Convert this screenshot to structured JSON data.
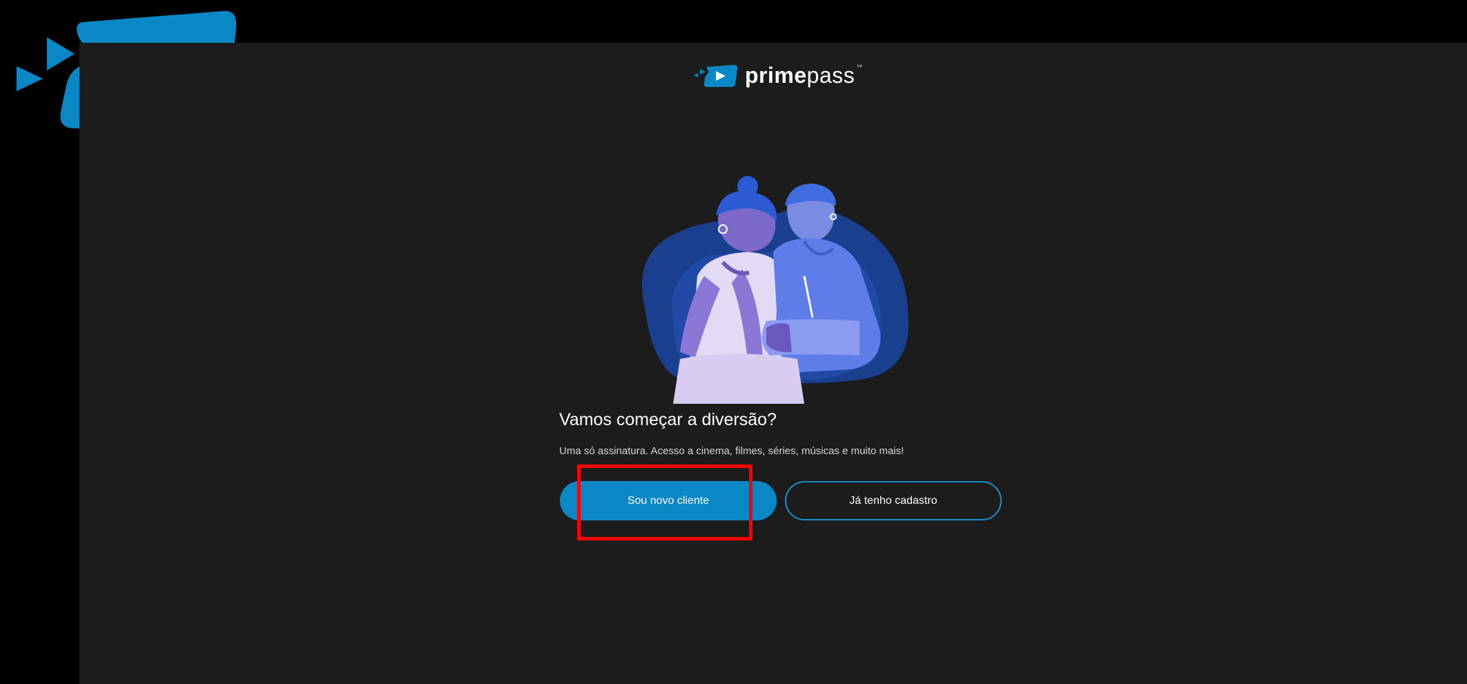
{
  "brand": {
    "name_bold": "prime",
    "name_light": "pass",
    "trademark": "™",
    "accent_color": "#0a88c6"
  },
  "icons": {
    "corner_logo": "play-icon",
    "brand_logo": "play-icon"
  },
  "illustration": {
    "name": "couple-illustration"
  },
  "main": {
    "heading": "Vamos começar a diversão?",
    "subtitle": "Uma só assinatura. Acesso a cinema, filmes, séries, músicas e muito mais!",
    "primary_button": "Sou novo cliente",
    "secondary_button": "Já tenho cadastro"
  },
  "annotation": {
    "highlight_color": "#ff0000"
  }
}
